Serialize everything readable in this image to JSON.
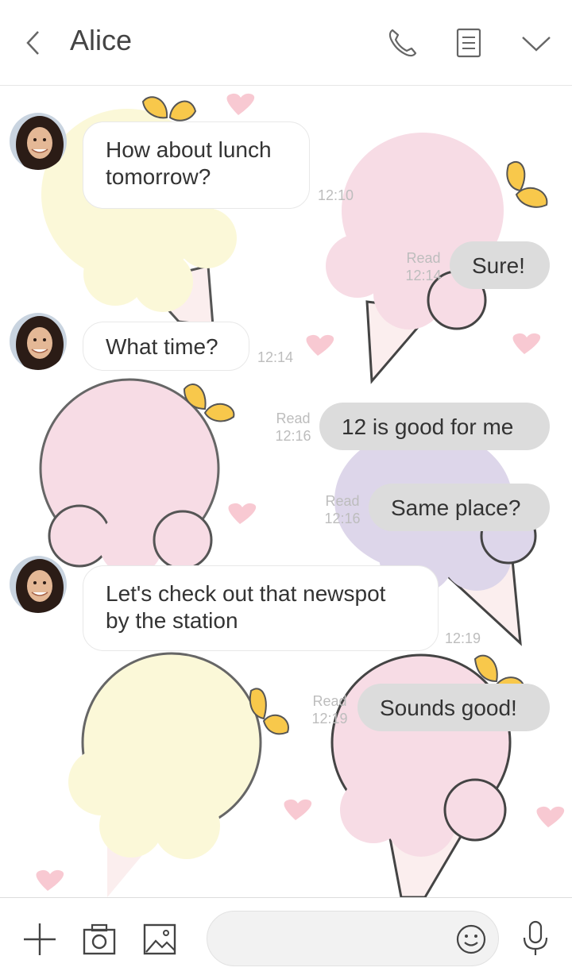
{
  "header": {
    "title": "Alice",
    "icons": [
      "back-chevron-icon",
      "phone-icon",
      "notes-icon",
      "chevron-down-icon"
    ]
  },
  "messages": [
    {
      "side": "in",
      "text_lines": [
        "How about lunch",
        "tomorrow?"
      ],
      "time": "12:10"
    },
    {
      "side": "out",
      "text": "Sure!",
      "read": "Read",
      "time": "12:14"
    },
    {
      "side": "in",
      "text": "What time?",
      "time": "12:14"
    },
    {
      "side": "out",
      "text": "12 is good for me",
      "read": "Read",
      "time": "12:16"
    },
    {
      "side": "out",
      "text": "Same place?",
      "read": "Read",
      "time": "12:16"
    },
    {
      "side": "in",
      "text_lines": [
        "Let's check out that newspot",
        "by the station"
      ],
      "time": "12:19"
    },
    {
      "side": "out",
      "text": "Sounds good!",
      "read": "Read",
      "time": "12:19"
    }
  ],
  "composer": {
    "placeholder": "",
    "icons": [
      "plus-icon",
      "camera-icon",
      "image-icon",
      "emoji-icon",
      "microphone-icon"
    ]
  },
  "colors": {
    "pink_scoop": "#f7dce5",
    "yellow_scoop": "#fbf8d8",
    "lavender_scoop": "#ddd6ea",
    "cone": "#fbeeee",
    "heart": "#f8c9d2",
    "butterfly": "#f8c84b",
    "outgoing_bubble": "#dcdcdc"
  }
}
